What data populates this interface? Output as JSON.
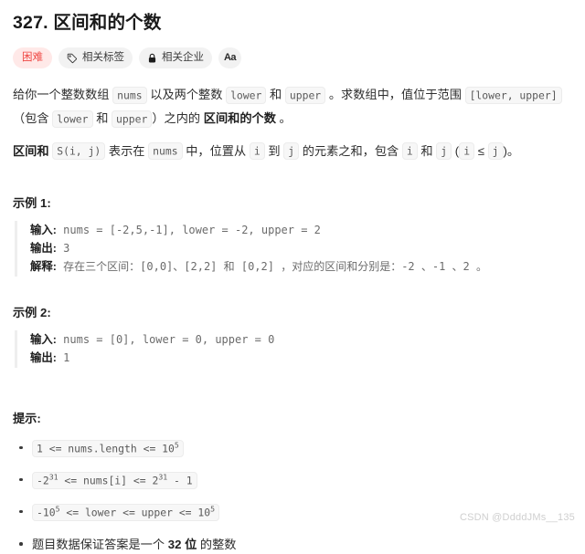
{
  "problem": {
    "title": "327. 区间和的个数",
    "difficulty": "困难",
    "tags_label": "相关标签",
    "companies_label": "相关企业",
    "font_button_label": "Aa"
  },
  "colors": {
    "difficulty_text": "#ef4743",
    "difficulty_bg": "#ffe9e8",
    "badge_bg": "#f2f2f2",
    "code_chip_bg": "#f7f7f7",
    "example_border": "#eeeeee",
    "watermark": "#cfcfcf"
  },
  "description": {
    "p1": {
      "t1": "给你一个整数数组 ",
      "c1": "nums",
      "t2": " 以及两个整数 ",
      "c2": "lower",
      "t3": " 和 ",
      "c3": "upper",
      "t4": " 。求数组中，值位于范围 ",
      "c4": "[lower, upper]",
      "t5": " （包含 ",
      "c5": "lower",
      "t6": " 和 ",
      "c6": "upper",
      "t7": "）之内的 ",
      "b1": "区间和的个数",
      "t8": " 。"
    },
    "p2": {
      "b1": "区间和",
      "c1": "S(i, j)",
      "t1": " 表示在 ",
      "c2": "nums",
      "t2": " 中，位置从 ",
      "c3": "i",
      "t3": " 到 ",
      "c4": "j",
      "t4": " 的元素之和，包含 ",
      "c5": "i",
      "t5": " 和 ",
      "c6": "j",
      "t6": " (",
      "c7": "i",
      "t7": " ≤ ",
      "c8": "j",
      "t8": ")。"
    }
  },
  "examples": [
    {
      "heading": "示例 1:",
      "input_label": "输入:",
      "input_value": " nums = [-2,5,-1], lower = -2, upper = 2",
      "output_label": "输出:",
      "output_value": " 3",
      "explain_label": "解释:",
      "explain_value": " 存在三个区间：[0,0]、[2,2] 和 [0,2] ，对应的区间和分别是：-2 、-1 、2 。"
    },
    {
      "heading": "示例 2:",
      "input_label": "输入:",
      "input_value": " nums = [0], lower = 0, upper = 0",
      "output_label": "输出:",
      "output_value": " 1"
    }
  ],
  "hints": {
    "heading": "提示:",
    "items": [
      {
        "type": "code",
        "parts": [
          {
            "text": "1 <= nums.length <= 10"
          },
          {
            "sup": "5"
          }
        ]
      },
      {
        "type": "code",
        "parts": [
          {
            "text": "-2"
          },
          {
            "sup": "31"
          },
          {
            "text": " <= nums[i] <= 2"
          },
          {
            "sup": "31"
          },
          {
            "text": " - 1"
          }
        ]
      },
      {
        "type": "code",
        "parts": [
          {
            "text": "-10"
          },
          {
            "sup": "5"
          },
          {
            "text": " <= lower <= upper <= 10"
          },
          {
            "sup": "5"
          }
        ]
      },
      {
        "type": "text",
        "prefix": "题目数据保证答案是一个 ",
        "bold": "32 位",
        "suffix": " 的整数"
      }
    ]
  },
  "watermark": "CSDN @DdddJMs__135"
}
